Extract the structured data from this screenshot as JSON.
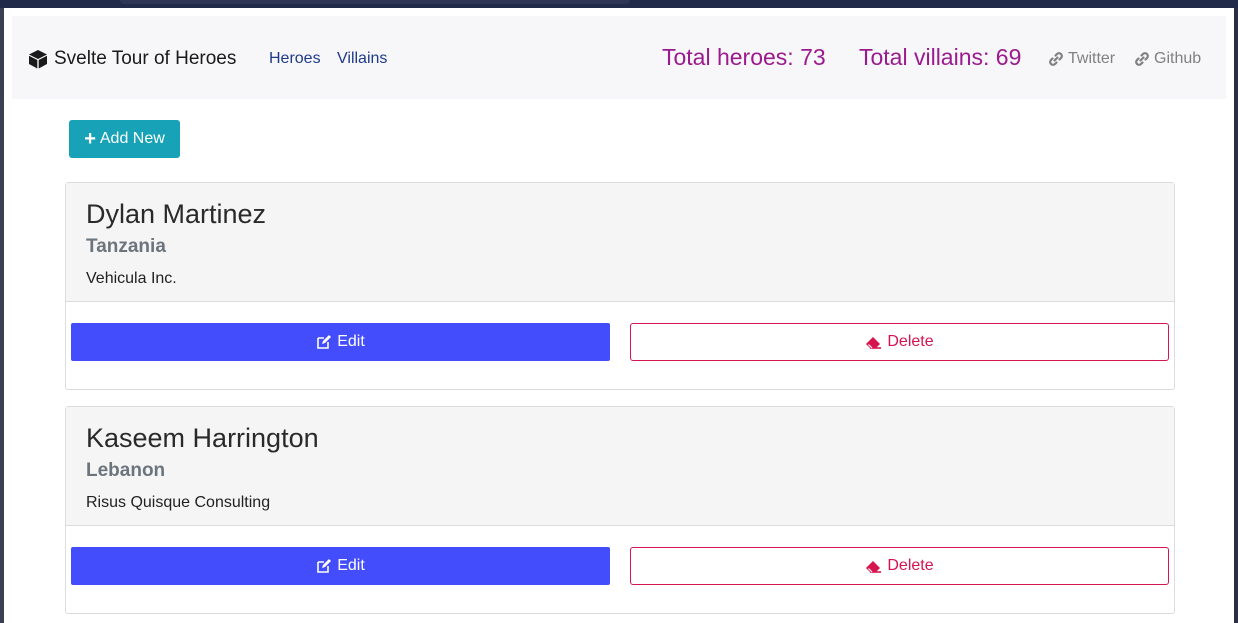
{
  "navbar": {
    "brand": "Svelte Tour of Heroes",
    "links": [
      "Heroes",
      "Villains"
    ],
    "total_heroes": "Total heroes: 73",
    "total_villains": "Total villains: 69",
    "twitter": "Twitter",
    "github": "Github"
  },
  "toolbar": {
    "add_label": "Add New"
  },
  "colors": {
    "accent_teal": "#17a2b8",
    "edit_blue": "#434dfb",
    "delete_red": "#d6144f",
    "stat_purple": "#9b1b8f"
  },
  "icons": {
    "brand": "cube-icon",
    "external": "link-icon",
    "add": "plus-icon",
    "edit": "edit-icon",
    "delete": "eraser-icon"
  },
  "cards": [
    {
      "name": "Dylan Martinez",
      "country": "Tanzania",
      "company": "Vehicula Inc.",
      "edit_label": "Edit",
      "delete_label": "Delete"
    },
    {
      "name": "Kaseem Harrington",
      "country": "Lebanon",
      "company": "Risus Quisque Consulting",
      "edit_label": "Edit",
      "delete_label": "Delete"
    }
  ]
}
